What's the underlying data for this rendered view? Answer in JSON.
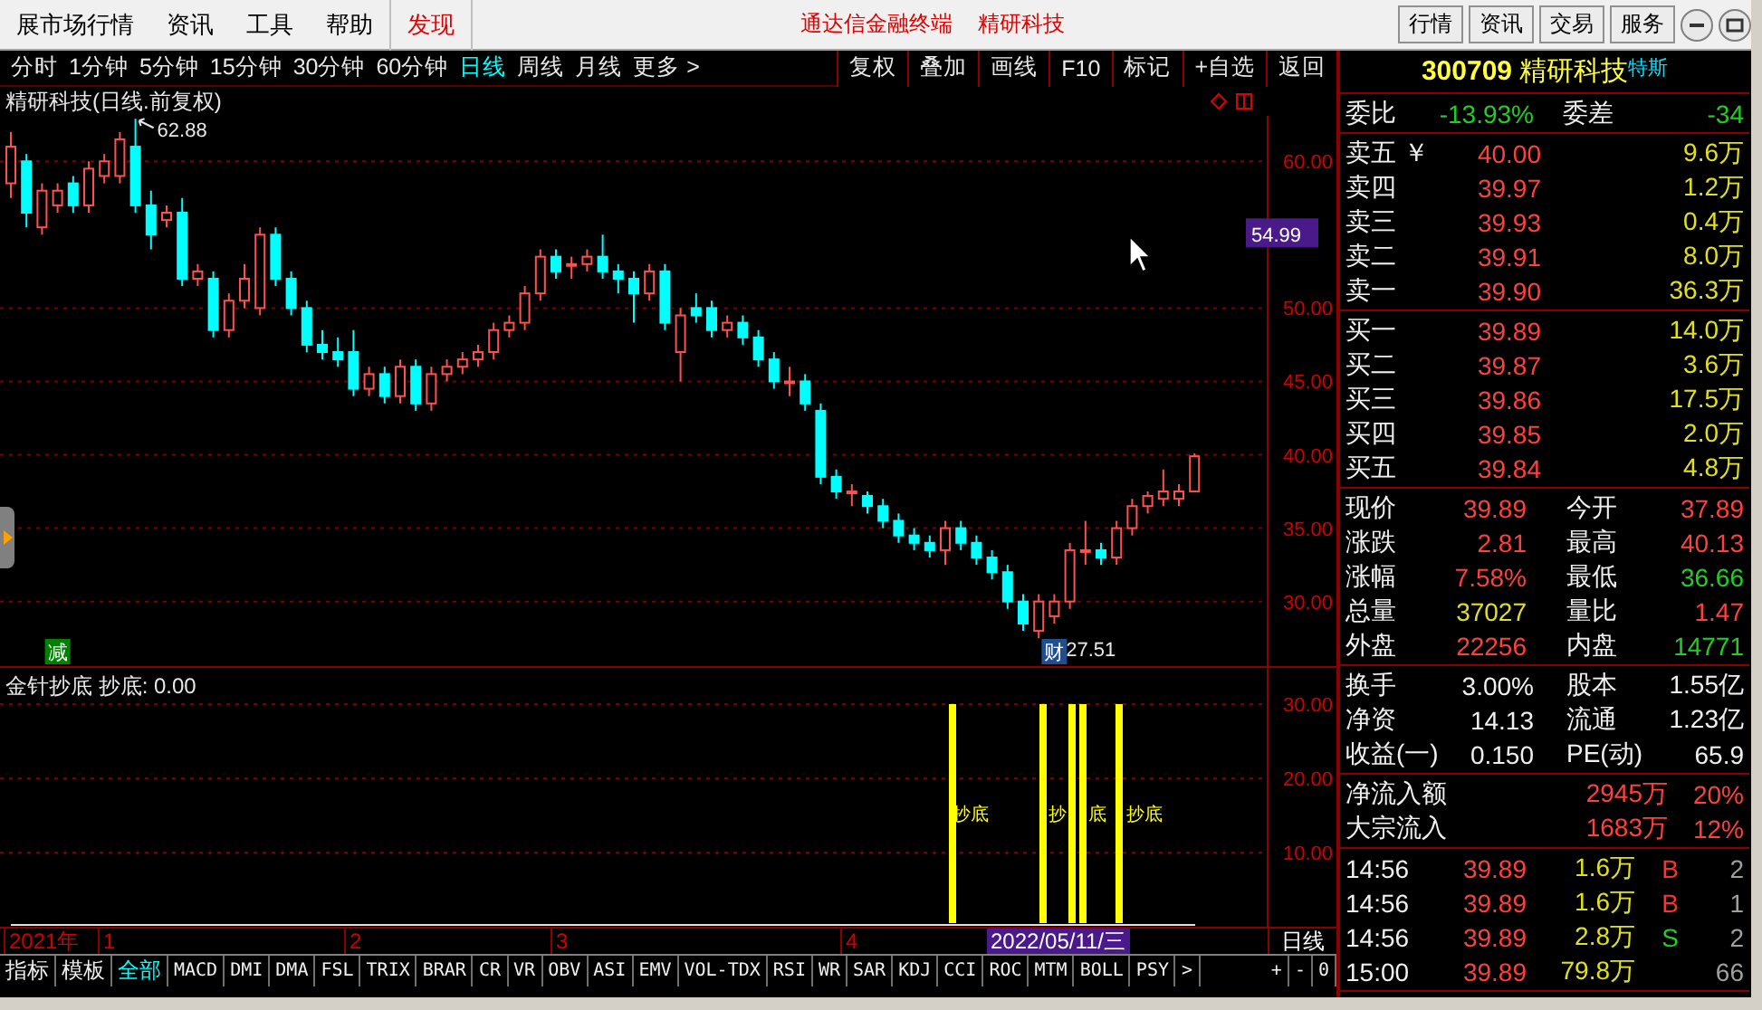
{
  "menu": {
    "items": [
      {
        "label": "展市场行情",
        "selected": false
      },
      {
        "label": "资讯",
        "selected": false
      },
      {
        "label": "工具",
        "selected": false
      },
      {
        "label": "帮助",
        "selected": false
      },
      {
        "label": "发现",
        "selected": true
      }
    ],
    "titles": [
      "通达信金融终端",
      "精研科技"
    ],
    "buttons": [
      "行情",
      "资讯",
      "交易",
      "服务"
    ]
  },
  "periods": [
    {
      "label": "分时",
      "selected": false
    },
    {
      "label": "1分钟",
      "selected": false
    },
    {
      "label": "5分钟",
      "selected": false
    },
    {
      "label": "15分钟",
      "selected": false
    },
    {
      "label": "30分钟",
      "selected": false
    },
    {
      "label": "60分钟",
      "selected": false
    },
    {
      "label": "日线",
      "selected": true
    },
    {
      "label": "周线",
      "selected": false
    },
    {
      "label": "月线",
      "selected": false
    },
    {
      "label": "更多 >",
      "selected": false
    }
  ],
  "tools": [
    "复权",
    "叠加",
    "画线",
    "F10",
    "标记",
    "+自选",
    "返回"
  ],
  "chart": {
    "title": "精研科技(日线.前复权)",
    "high_label": "62.88",
    "low_label": "27.51",
    "price_tag": "54.99",
    "y_labels": [
      "60.00",
      "50.00",
      "45.00",
      "40.00",
      "35.00",
      "30.00"
    ],
    "badges": [
      {
        "text": "减",
        "color": "#008000"
      },
      {
        "text": "财",
        "color": "#1f4f8f"
      }
    ]
  },
  "indicator": {
    "title": "金针抄底",
    "reading": "抄底: 0.00",
    "y_labels": [
      "30.00",
      "20.00",
      "10.00"
    ],
    "signals": [
      "抄底",
      "抄",
      "底",
      "抄底"
    ]
  },
  "time_axis": {
    "labels": [
      "2021年",
      "1",
      "2",
      "3",
      "4"
    ],
    "cursor_date": "2022/05/11/三",
    "period": "日线"
  },
  "tabs": [
    {
      "label": "指标",
      "selected": false
    },
    {
      "label": "模板",
      "selected": false
    },
    {
      "label": "全部",
      "selected": true
    },
    {
      "label": "MACD",
      "selected": false
    },
    {
      "label": "DMI",
      "selected": false
    },
    {
      "label": "DMA",
      "selected": false
    },
    {
      "label": "FSL",
      "selected": false
    },
    {
      "label": "TRIX",
      "selected": false
    },
    {
      "label": "BRAR",
      "selected": false
    },
    {
      "label": "CR",
      "selected": false
    },
    {
      "label": "VR",
      "selected": false
    },
    {
      "label": "OBV",
      "selected": false
    },
    {
      "label": "ASI",
      "selected": false
    },
    {
      "label": "EMV",
      "selected": false
    },
    {
      "label": "VOL-TDX",
      "selected": false
    },
    {
      "label": "RSI",
      "selected": false
    },
    {
      "label": "WR",
      "selected": false
    },
    {
      "label": "SAR",
      "selected": false
    },
    {
      "label": "KDJ",
      "selected": false
    },
    {
      "label": "CCI",
      "selected": false
    },
    {
      "label": "ROC",
      "selected": false
    },
    {
      "label": "MTM",
      "selected": false
    },
    {
      "label": "BOLL",
      "selected": false
    },
    {
      "label": "PSY",
      "selected": false
    }
  ],
  "tabs_more": ">",
  "zoom_buttons": [
    "+",
    "-",
    "0"
  ],
  "quote": {
    "code": "300709",
    "name": "精研科技",
    "tag": "特斯",
    "ratio": [
      {
        "label": "委比",
        "value": "-13.93%",
        "color": "#20d020"
      },
      {
        "label": "委差",
        "value": "-34",
        "color": "#20d020"
      }
    ],
    "asks": [
      {
        "label": "卖五",
        "flag": "￥",
        "price": "40.00",
        "volume": "9.6万"
      },
      {
        "label": "卖四",
        "price": "39.97",
        "volume": "1.2万"
      },
      {
        "label": "卖三",
        "price": "39.93",
        "volume": "0.4万"
      },
      {
        "label": "卖二",
        "price": "39.91",
        "volume": "8.0万"
      },
      {
        "label": "卖一",
        "price": "39.90",
        "volume": "36.3万"
      }
    ],
    "bids": [
      {
        "label": "买一",
        "price": "39.89",
        "volume": "14.0万"
      },
      {
        "label": "买二",
        "price": "39.87",
        "volume": "3.6万"
      },
      {
        "label": "买三",
        "price": "39.86",
        "volume": "17.5万"
      },
      {
        "label": "买四",
        "price": "39.85",
        "volume": "2.0万"
      },
      {
        "label": "买五",
        "price": "39.84",
        "volume": "4.8万"
      }
    ],
    "stats": [
      [
        {
          "label": "现价",
          "value": "39.89",
          "color": "#ff4040"
        },
        {
          "label": "今开",
          "value": "37.89",
          "color": "#ff4040"
        }
      ],
      [
        {
          "label": "涨跌",
          "value": "2.81",
          "color": "#ff4040"
        },
        {
          "label": "最高",
          "value": "40.13",
          "color": "#ff4040"
        }
      ],
      [
        {
          "label": "涨幅",
          "value": "7.58%",
          "color": "#ff4040"
        },
        {
          "label": "最低",
          "value": "36.66",
          "color": "#20d020"
        }
      ],
      [
        {
          "label": "总量",
          "value": "37027",
          "color": "#e0e020"
        },
        {
          "label": "量比",
          "value": "1.47",
          "color": "#ff4040"
        }
      ],
      [
        {
          "label": "外盘",
          "value": "22256",
          "color": "#ff4040"
        },
        {
          "label": "内盘",
          "value": "14771",
          "color": "#20d020"
        }
      ]
    ],
    "fundamentals": [
      [
        {
          "label": "换手",
          "value": "3.00%"
        },
        {
          "label": "股本",
          "value": "1.55亿"
        }
      ],
      [
        {
          "label": "净资",
          "value": "14.13"
        },
        {
          "label": "流通",
          "value": "1.23亿"
        }
      ],
      [
        {
          "label": "收益(一)",
          "value": "0.150"
        },
        {
          "label": "PE(动)",
          "value": "65.9"
        }
      ]
    ],
    "flows": [
      {
        "label": "净流入额",
        "amount": "2945万",
        "share": "20%"
      },
      {
        "label": "大宗流入",
        "amount": "1683万",
        "share": "12%"
      }
    ],
    "ticks": [
      {
        "time": "14:56",
        "price": "39.89",
        "volume": "1.6万",
        "side": "B",
        "count": "2"
      },
      {
        "time": "14:56",
        "price": "39.89",
        "volume": "1.6万",
        "side": "B",
        "count": "1"
      },
      {
        "time": "14:56",
        "price": "39.89",
        "volume": "2.8万",
        "side": "S",
        "count": "2"
      },
      {
        "time": "15:00",
        "price": "39.89",
        "volume": "79.8万",
        "count": "66"
      }
    ]
  }
}
